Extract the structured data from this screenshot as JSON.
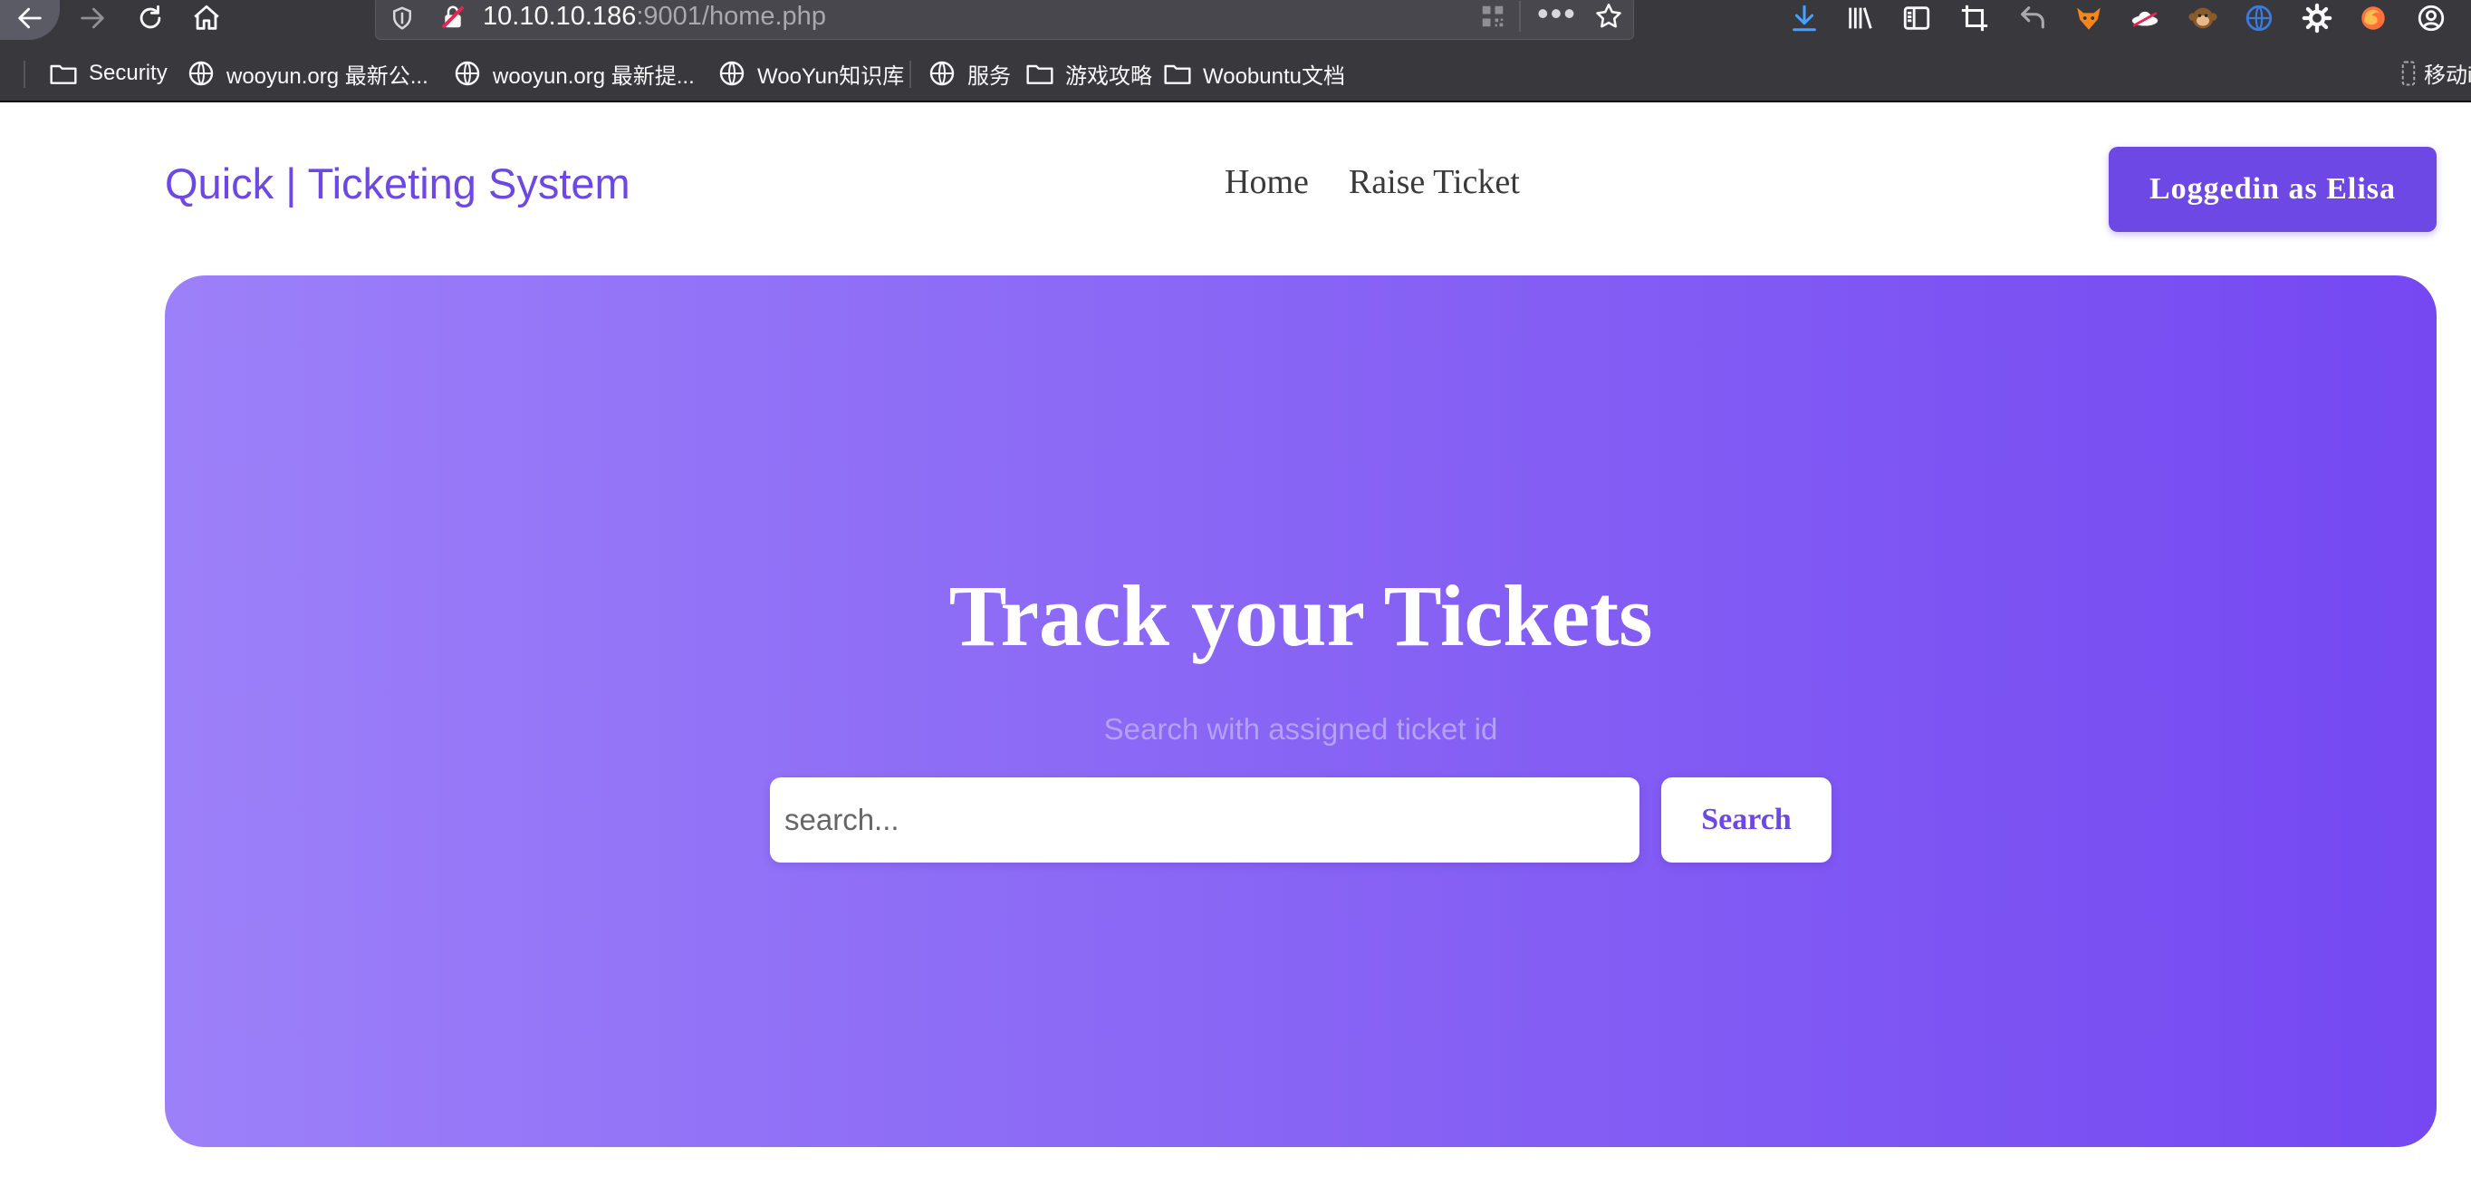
{
  "browser": {
    "url_host": "10.10.10.186",
    "url_rest": ":9001/home.php",
    "icons": [
      "back-icon",
      "forward-icon",
      "reload-icon",
      "home-icon",
      "shield-icon",
      "insecure-lock-icon",
      "qr-code-icon",
      "more-icon",
      "bookmark-star-icon",
      "download-icon",
      "library-icon",
      "sidebar-icon",
      "crop-icon",
      "undo-icon",
      "fox-extension-icon",
      "ufo-extension-icon",
      "monkey-extension-icon",
      "globe-extension-icon",
      "gear-icon",
      "firefox-extension-icon",
      "account-icon"
    ],
    "download_color": "#45a1ff",
    "bookmarks": [
      {
        "label": "Security",
        "icon": "folder-icon"
      },
      {
        "label": "wooyun.org 最新公...",
        "icon": "globe-icon"
      },
      {
        "label": "wooyun.org 最新提...",
        "icon": "globe-icon"
      },
      {
        "label": "WooYun知识库",
        "icon": "globe-icon"
      },
      {
        "label": "服务",
        "icon": "globe-icon"
      },
      {
        "label": "游戏攻略",
        "icon": "folder-icon"
      },
      {
        "label": "Woobuntu文档",
        "icon": "folder-icon"
      }
    ],
    "mobile_bookmarks": "移动i"
  },
  "site": {
    "brand": "Quick | Ticketing System",
    "nav": [
      "Home",
      "Raise Ticket"
    ],
    "login_button": "Loggedin as Elisa",
    "accent_color": "#6d48e5"
  },
  "hero": {
    "title": "Track your Tickets",
    "subtitle": "Search with assigned ticket id",
    "search_placeholder": "search...",
    "search_button": "Search",
    "gradient": [
      "#9c80f9",
      "#7548f2"
    ]
  }
}
